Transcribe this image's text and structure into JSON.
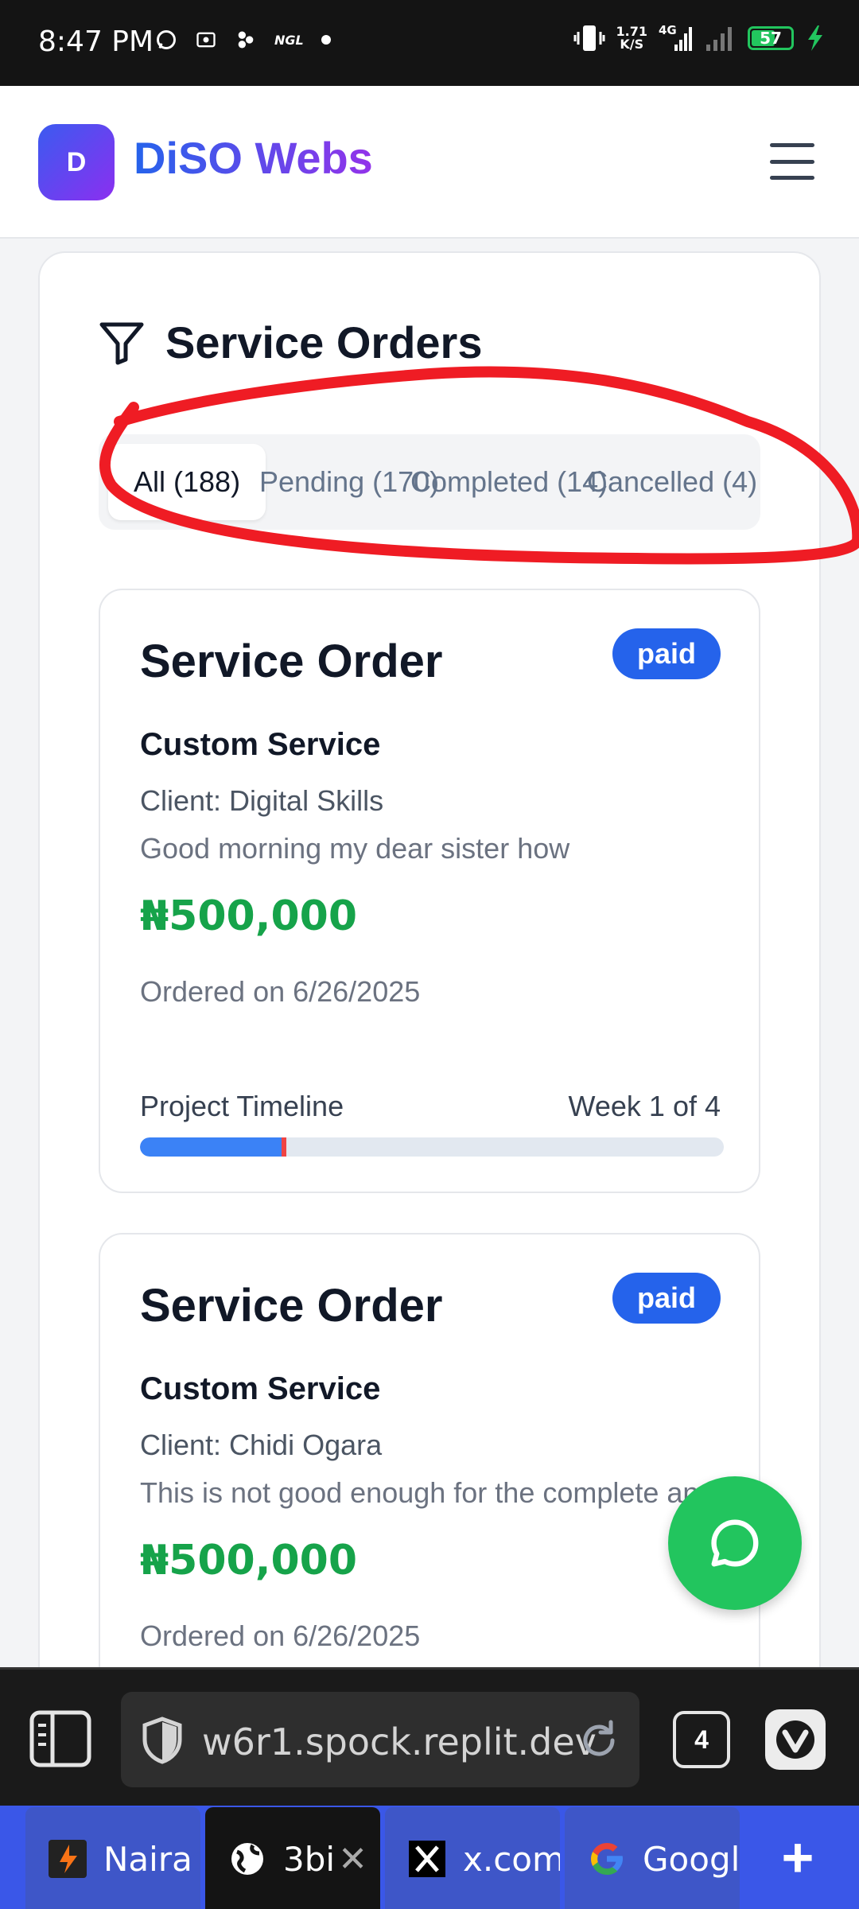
{
  "status_bar": {
    "time": "8:47 PM",
    "ngl": "NGL",
    "speed_value": "1.71",
    "speed_unit": "K/S",
    "network": "4G",
    "battery": "57"
  },
  "header": {
    "logo_letter": "D",
    "brand": "DiSO Webs"
  },
  "page": {
    "title": "Service Orders",
    "tabs": [
      {
        "label": "All (188)",
        "active": true
      },
      {
        "label": "Pending (170)",
        "active": false
      },
      {
        "label": "Completed (14)",
        "active": false
      },
      {
        "label": "Cancelled (4)",
        "active": false
      }
    ]
  },
  "orders": [
    {
      "title": "Service Order",
      "status": "paid",
      "service": "Custom Service",
      "client": "Client: Digital Skills",
      "message": "Good morning my dear sister how",
      "amount": "₦500,000",
      "ordered": "Ordered on 6/26/2025",
      "timeline_label": "Project Timeline",
      "timeline_week": "Week 1 of 4",
      "progress_fraction": 0.25
    },
    {
      "title": "Service Order",
      "status": "paid",
      "service": "Custom Service",
      "client": "Client: Chidi Ogara",
      "message": "This is not good enough for the complete and",
      "amount": "₦500,000",
      "ordered": "Ordered on 6/26/2025"
    }
  ],
  "browser": {
    "url": "w6r1.spock.replit.dev",
    "tab_count": "4",
    "tabs": [
      {
        "title": "Naira",
        "icon": "app-icon",
        "active": false
      },
      {
        "title": "3bi",
        "icon": "globe-icon",
        "active": true
      },
      {
        "title": "x.com",
        "icon": "x-logo-icon",
        "active": false
      },
      {
        "title": "Google",
        "icon": "google-icon",
        "active": false
      }
    ]
  },
  "colors": {
    "brand_start": "#2563eb",
    "brand_end": "#9333ea",
    "badge": "#2563eb",
    "amount": "#16a34a",
    "progress": "#3b82f6",
    "fab": "#22c55e",
    "annotation": "#ef1c24"
  }
}
